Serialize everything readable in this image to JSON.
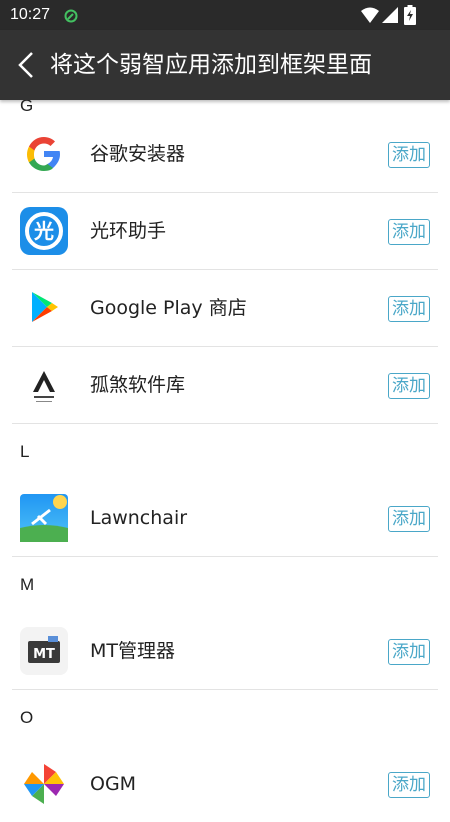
{
  "status_bar": {
    "time": "10:27",
    "icons": [
      "leaf-icon",
      "wifi-icon",
      "signal-icon",
      "battery-icon"
    ]
  },
  "app_bar": {
    "title": "将这个弱智应用添加到框架里面",
    "back_icon": "chevron-left-icon"
  },
  "colors": {
    "status_bar_bg": "#2a2a2a",
    "app_bar_bg": "#333333",
    "accent": "#4aa7c8",
    "divider": "#e3e3e3"
  },
  "sections": [
    {
      "letter": "G",
      "apps": [
        {
          "name": "谷歌安装器",
          "action": "添加",
          "icon": "google-icon"
        },
        {
          "name": "光环助手",
          "action": "添加",
          "icon": "guanghuan-icon"
        },
        {
          "name": "Google Play 商店",
          "action": "添加",
          "icon": "google-play-icon"
        },
        {
          "name": "孤煞软件库",
          "action": "添加",
          "icon": "gusha-library-icon"
        }
      ]
    },
    {
      "letter": "L",
      "apps": [
        {
          "name": "Lawnchair",
          "action": "添加",
          "icon": "lawnchair-icon"
        }
      ]
    },
    {
      "letter": "M",
      "apps": [
        {
          "name": "MT管理器",
          "action": "添加",
          "icon": "mt-manager-icon"
        }
      ]
    },
    {
      "letter": "O",
      "apps": [
        {
          "name": "OGM",
          "action": "添加",
          "icon": "ogm-icon"
        }
      ]
    }
  ]
}
